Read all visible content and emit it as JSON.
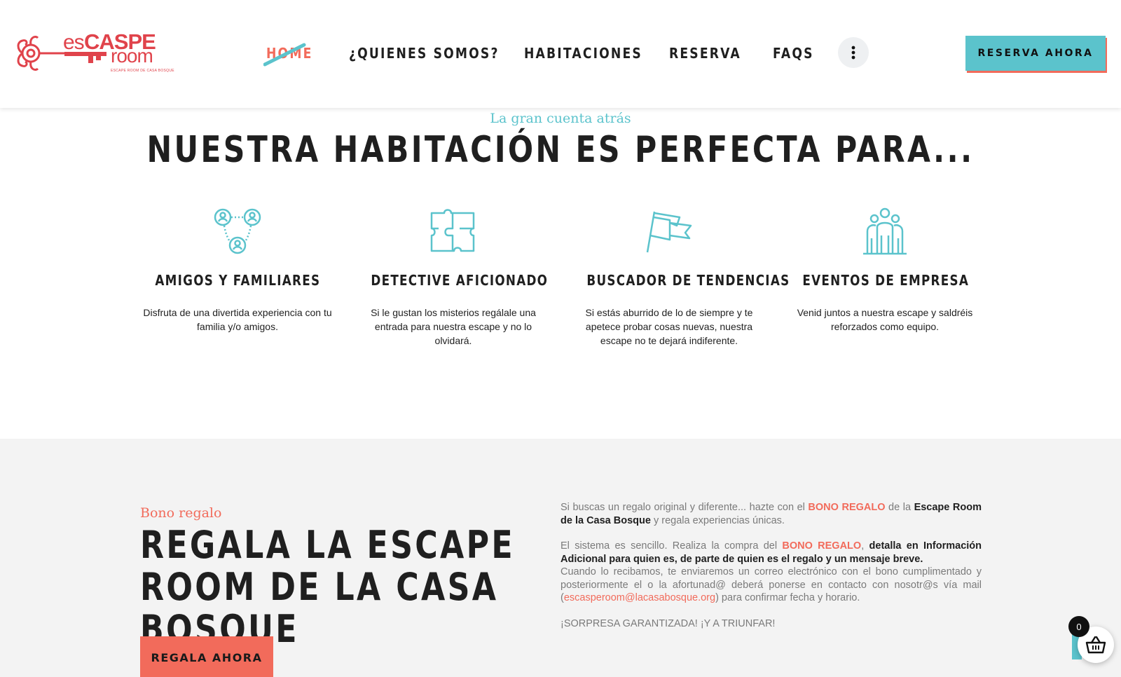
{
  "header": {
    "logo": {
      "es": "es",
      "caspe": "CASPE",
      "room": "room",
      "tagline": "ESCAPE ROOM DE CASA BOSQUE"
    },
    "nav": [
      {
        "label": "HOME",
        "active": true
      },
      {
        "label": "¿QUIENES SOMOS?"
      },
      {
        "label": "HABITACIONES"
      },
      {
        "label": "RESERVA"
      },
      {
        "label": "FAQS"
      }
    ],
    "cta_label": "RESERVA AHORA"
  },
  "features_section": {
    "kicker": "La gran cuenta atrás",
    "title": "NUESTRA HABITACIÓN ES PERFECTA PARA...",
    "items": [
      {
        "icon": "group-icon",
        "title": "AMIGOS Y FAMILIARES",
        "desc": "Disfruta de una divertida experiencia con tu familia y/o amigos."
      },
      {
        "icon": "puzzle-icon",
        "title": "DETECTIVE AFICIONADO",
        "desc": "Si le gustan los misterios regálale una entrada para nuestra escape y no lo olvidará."
      },
      {
        "icon": "flag-icon",
        "title": "BUSCADOR DE TENDENCIAS",
        "desc": "Si estás aburrido de lo de siempre y te apetece probar cosas nuevas, nuestra escape no te dejará indiferente."
      },
      {
        "icon": "team-icon",
        "title": "EVENTOS DE EMPRESA",
        "desc": "Venid juntos a nuestra escape y saldréis reforzados como equipo."
      }
    ]
  },
  "gift_section": {
    "kicker": "Bono regalo",
    "title": "REGALA LA ESCAPE ROOM DE LA CASA BOSQUE",
    "button_label": "REGALA AHORA",
    "p1_a": "Si buscas un regalo original y diferente... hazte con el ",
    "p1_accent": "BONO REGALO",
    "p1_b": " de la ",
    "p1_strong": "Escape Room de la Casa Bosque",
    "p1_c": " y regala experiencias únicas.",
    "p2_a": "El sistema es sencillo. Realiza la compra del ",
    "p2_accent": "BONO REGALO",
    "p2_b": ", ",
    "p2_strong": "detalla en Información Adicional para quien es, de parte de quien es el regalo y un mensaje breve.",
    "p3_a": "Cuando lo recibamos, te enviaremos un correo electrónico con el bono cumplimentado y posteriormente el o la afortunad@ deberá ponerse en contacto con nosotr@s vía mail (",
    "p3_mail": "escasperoom@lacasabosque.org",
    "p3_b": ") para confirmar fecha y horario.",
    "p4": "¡SORPRESA GARANTIZADA! ¡Y A TRIUNFAR!"
  },
  "cart": {
    "count": "0"
  },
  "colors": {
    "accent": "#f26b5b",
    "teal": "#5bc3cc",
    "logo_red": "#e0434b"
  }
}
